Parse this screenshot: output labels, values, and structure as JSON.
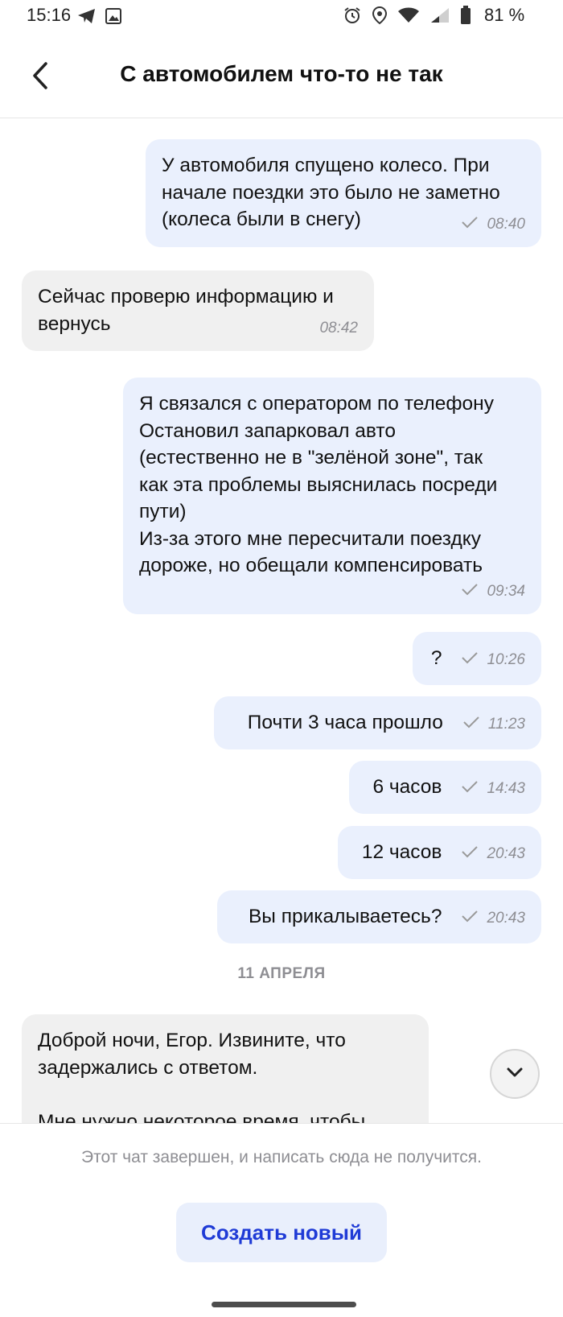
{
  "status_bar": {
    "time": "15:16",
    "battery": "81 %",
    "left_icons": [
      "telegram-icon",
      "gallery-icon"
    ],
    "right_icons": [
      "alarm-icon",
      "location-icon",
      "wifi-icon",
      "signal-icon",
      "battery-icon"
    ]
  },
  "header": {
    "title": "С автомобилем что-то не так",
    "back_icon": "chevron-left-icon"
  },
  "messages": [
    {
      "dir": "out",
      "text": "У автомобиля спущено колесо. При\nначале поездки это было не заметно\n(колеса были в снегу)",
      "time": "08:40"
    },
    {
      "dir": "in",
      "text": "Сейчас проверю информацию и\nвернусь",
      "time": "08:42"
    },
    {
      "dir": "out",
      "text": "Я связался с оператором по телефону\nОстановил запарковал авто\n(естественно не в \"зелёной зоне\", так\nкак эта проблемы выяснилась посреди\nпути)\nИз-за этого мне пересчитали поездку\nдороже, но обещали компенсировать",
      "time": "09:34"
    },
    {
      "dir": "out",
      "text": "?",
      "time": "10:26"
    },
    {
      "dir": "out",
      "text": "Почти 3 часа прошло",
      "time": "11:23"
    },
    {
      "dir": "out",
      "text": "6 часов",
      "time": "14:43"
    },
    {
      "dir": "out",
      "text": "12 часов",
      "time": "20:43"
    },
    {
      "dir": "out",
      "text": "Вы прикалываетесь?",
      "time": "20:43"
    },
    {
      "dir": "in",
      "text": "Доброй ночи, Егор. Извините, что\nзадержались с ответом.\n\nМне нужно некоторое время, чтобы",
      "time": ""
    }
  ],
  "date_divider": "11 АПРЕЛЯ",
  "footer": {
    "closed_text": "Этот чат завершен, и написать сюда не получится.",
    "create_button": "Создать новый"
  },
  "colors": {
    "outgoing_bubble": "#eaf0fd",
    "incoming_bubble": "#f0f0f0",
    "accent": "#1f3bd6"
  }
}
